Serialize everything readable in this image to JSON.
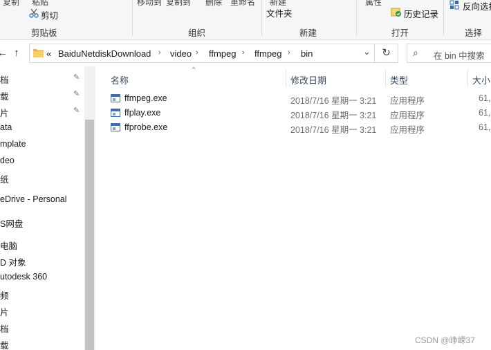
{
  "ribbon": {
    "cut_top_labels": [
      "复制",
      "粘贴",
      "移动到",
      "复制到",
      "删除",
      "重命名",
      "新建",
      "属性",
      "反向选择"
    ],
    "cut_label": "剪切",
    "new_folder_label": "文件夹",
    "history_label": "历史记录",
    "invert_label": "反向选择",
    "groups": [
      "剪贴板",
      "组织",
      "新建",
      "打开",
      "选择"
    ]
  },
  "address": {
    "back_label": "←",
    "up_label": "↑",
    "overflow_label": "«",
    "crumbs": [
      "BaiduNetdiskDownload",
      "video",
      "ffmpeg",
      "ffmpeg",
      "bin"
    ],
    "chevron": "›",
    "dropdown_label": "⌄",
    "refresh_label": "↻",
    "search_icon": "⌕",
    "search_placeholder": "在 bin 中搜索"
  },
  "nav_pane": {
    "items": [
      "档",
      "载",
      "片",
      "ata",
      "mplate",
      "deo",
      "纸",
      "eDrive - Personal",
      "S网盘",
      "电脑",
      "D 对象",
      "utodesk 360",
      "频",
      "片",
      "档",
      "载"
    ],
    "pin_icon": "✎"
  },
  "columns": {
    "name": "名称",
    "date": "修改日期",
    "type": "类型",
    "size": "大小"
  },
  "files": [
    {
      "name": "ffmpeg.exe",
      "date": "2018/7/16 星期一 3:21",
      "type": "应用程序",
      "size": "61,"
    },
    {
      "name": "ffplay.exe",
      "date": "2018/7/16 星期一 3:21",
      "type": "应用程序",
      "size": "61,"
    },
    {
      "name": "ffprobe.exe",
      "date": "2018/7/16 星期一 3:21",
      "type": "应用程序",
      "size": "61,"
    }
  ],
  "watermark": "CSDN @峥嵘37",
  "colors": {
    "ribbon_bg": "#f5f6f7",
    "header_text": "#3c4a5c",
    "folder_yellow": "#e8b83a",
    "exe_blue": "#3b6fb0"
  }
}
